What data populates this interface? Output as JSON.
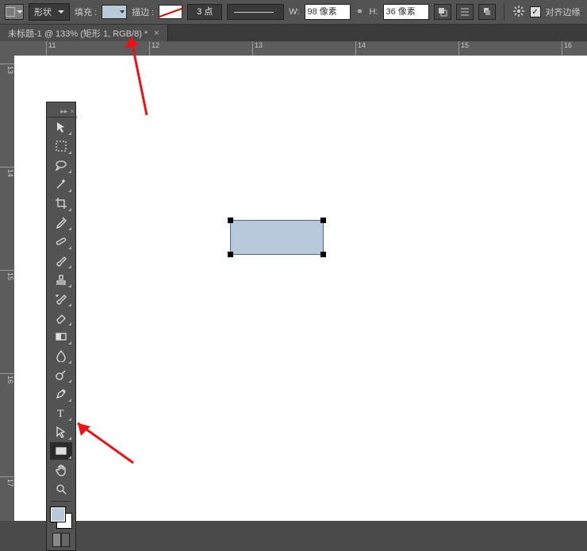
{
  "options_bar": {
    "tool_mode": "形状",
    "fill_label": "填充 :",
    "fill_color": "#b8c9db",
    "stroke_label": "描边 :",
    "stroke_size": "3 点",
    "w_label": "W:",
    "w_value": "98 像素",
    "h_label": "H:",
    "h_value": "36 像素",
    "align_label": "对齐边缘"
  },
  "document_tab": {
    "title": "未标题-1 @ 133% (矩形 1, RGB/8) *"
  },
  "ruler_h": [
    "11",
    "12",
    "13",
    "14",
    "15",
    "16"
  ],
  "ruler_v": [
    "13",
    "14",
    "15",
    "16",
    "17"
  ],
  "shape": {
    "fill": "#b8c9db"
  },
  "tools": [
    {
      "name": "move-tool",
      "icon": "move",
      "fly": true
    },
    {
      "name": "marquee-tool",
      "icon": "marquee",
      "fly": true
    },
    {
      "name": "lasso-tool",
      "icon": "lasso",
      "fly": true
    },
    {
      "name": "magic-wand-tool",
      "icon": "wand",
      "fly": true
    },
    {
      "name": "crop-tool",
      "icon": "crop",
      "fly": true
    },
    {
      "name": "eyedropper-tool",
      "icon": "eyedrop",
      "fly": true
    },
    {
      "name": "healing-brush-tool",
      "icon": "bandaid",
      "fly": true
    },
    {
      "name": "brush-tool",
      "icon": "brush",
      "fly": true
    },
    {
      "name": "clone-stamp-tool",
      "icon": "stamp",
      "fly": true
    },
    {
      "name": "history-brush-tool",
      "icon": "histbrush",
      "fly": true
    },
    {
      "name": "eraser-tool",
      "icon": "eraser",
      "fly": true
    },
    {
      "name": "gradient-tool",
      "icon": "gradient",
      "fly": true
    },
    {
      "name": "blur-tool",
      "icon": "blur",
      "fly": true
    },
    {
      "name": "dodge-tool",
      "icon": "dodge",
      "fly": true
    },
    {
      "name": "pen-tool",
      "icon": "pen",
      "fly": true
    },
    {
      "name": "type-tool",
      "icon": "type",
      "fly": true
    },
    {
      "name": "path-selection-tool",
      "icon": "pathsel",
      "fly": true
    },
    {
      "name": "rectangle-shape-tool",
      "icon": "rect",
      "fly": true,
      "selected": true
    },
    {
      "name": "hand-tool",
      "icon": "hand",
      "fly": false
    },
    {
      "name": "zoom-tool",
      "icon": "zoom",
      "fly": false
    }
  ],
  "colors": {
    "fg": "#b8c9db",
    "bg": "#ffffff"
  }
}
